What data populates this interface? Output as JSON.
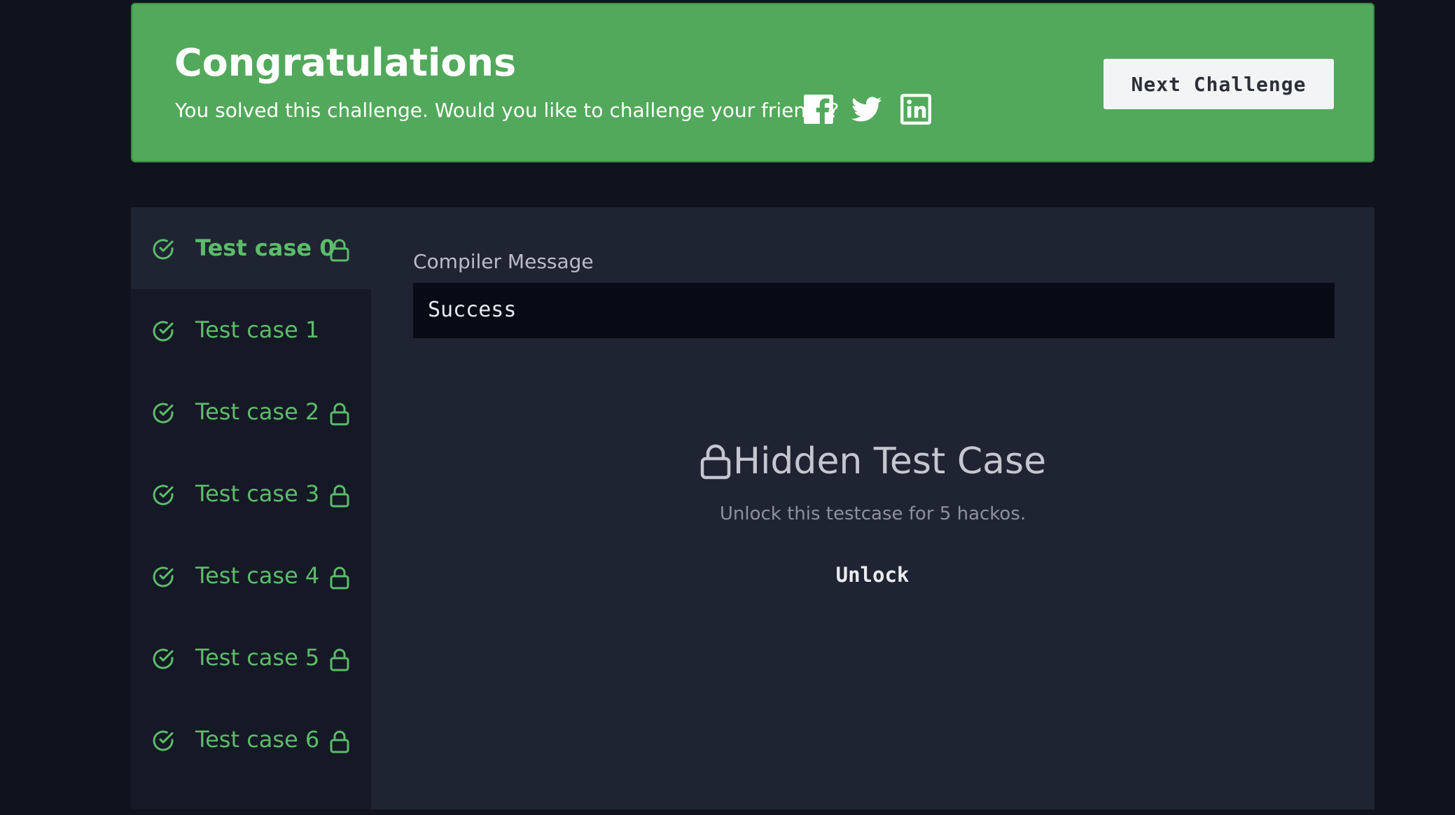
{
  "banner": {
    "title": "Congratulations",
    "subtitle": "You solved this challenge. Would you like to challenge your friends?",
    "share_icons": [
      "facebook-icon",
      "twitter-icon",
      "linkedin-icon"
    ],
    "next_button_label": "Next Challenge",
    "background_color": "#52a95b"
  },
  "test_cases": {
    "items": [
      {
        "label": "Test case 0",
        "passed": true,
        "locked": true,
        "active": true
      },
      {
        "label": "Test case 1",
        "passed": true,
        "locked": false,
        "active": false
      },
      {
        "label": "Test case 2",
        "passed": true,
        "locked": true,
        "active": false
      },
      {
        "label": "Test case 3",
        "passed": true,
        "locked": true,
        "active": false
      },
      {
        "label": "Test case 4",
        "passed": true,
        "locked": true,
        "active": false
      },
      {
        "label": "Test case 5",
        "passed": true,
        "locked": true,
        "active": false
      },
      {
        "label": "Test case 6",
        "passed": true,
        "locked": true,
        "active": false
      }
    ],
    "pass_color": "#5cbc6a"
  },
  "result": {
    "compiler_label": "Compiler Message",
    "compiler_message": "Success",
    "hidden_title": "Hidden Test Case",
    "hidden_subtitle": "Unlock this testcase for 5 hackos.",
    "unlock_label": "Unlock"
  }
}
